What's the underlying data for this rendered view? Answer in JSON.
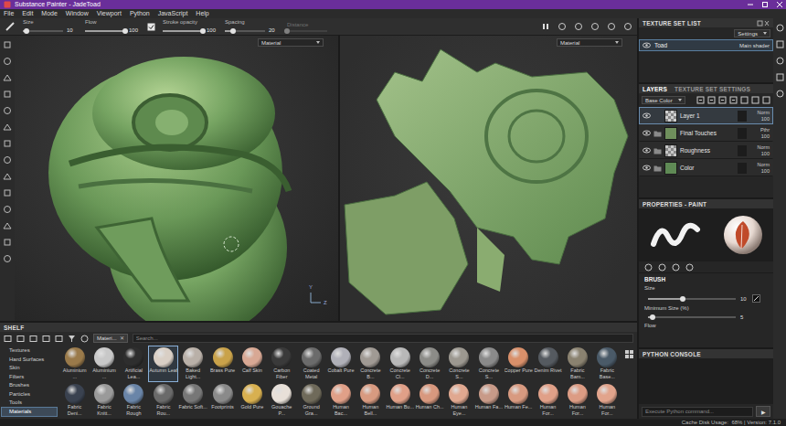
{
  "window": {
    "title": "Substance Painter - JadeToad"
  },
  "menu": [
    "File",
    "Edit",
    "Mode",
    "Window",
    "Viewport",
    "Python",
    "JavaScript",
    "Help"
  ],
  "toolbar": {
    "params": [
      {
        "label": "Size",
        "value": "10",
        "level": 0.1,
        "disabled": false
      },
      {
        "label": "Flow",
        "value": "100",
        "level": 1,
        "disabled": false
      },
      {
        "label": "Stroke opacity",
        "value": "100",
        "level": 1,
        "disabled": false
      },
      {
        "label": "Spacing",
        "value": "20",
        "level": 0.2,
        "disabled": false
      },
      {
        "label": "Distance",
        "value": "",
        "level": 0,
        "disabled": true
      }
    ]
  },
  "viewport_3d": {
    "dropdown": "Material",
    "axes": [
      "Y",
      "Z"
    ]
  },
  "viewport_2d": {
    "dropdown": "Material"
  },
  "texture_set_list": {
    "title": "TEXTURE SET LIST",
    "settings": "Settings",
    "items": [
      {
        "name": "Toad",
        "shader": "Main shader",
        "selected": true,
        "visible": true
      }
    ]
  },
  "layers": {
    "tabs": [
      {
        "label": "LAYERS",
        "selected": true
      },
      {
        "label": "TEXTURE SET SETTINGS",
        "selected": false
      }
    ],
    "channel": "Base Color",
    "items": [
      {
        "name": "Layer 1",
        "kind": "layer",
        "thumb": "checker",
        "color": "#d0d0d0",
        "blend": "Norm",
        "opacity": "100",
        "selected": true,
        "visible": true
      },
      {
        "name": "Final Touches",
        "kind": "folder",
        "thumb": "solid",
        "color": "#6f8f5c",
        "blend": "Pthr",
        "opacity": "100",
        "selected": false,
        "visible": true
      },
      {
        "name": "Roughness",
        "kind": "folder",
        "thumb": "checker",
        "color": "#c8c8c8",
        "blend": "Norm",
        "opacity": "100",
        "selected": false,
        "visible": true
      },
      {
        "name": "Color",
        "kind": "folder",
        "thumb": "solid",
        "color": "#5f8a55",
        "blend": "Norm",
        "opacity": "100",
        "selected": false,
        "visible": true
      }
    ]
  },
  "properties": {
    "title": "PROPERTIES - PAINT",
    "section": "BRUSH",
    "params": [
      {
        "label": "Size",
        "value": "10",
        "level": 0.4
      },
      {
        "label": "Minimum Size (%)",
        "value": "5",
        "level": 0.05
      }
    ],
    "extra_label": "Flow"
  },
  "python_console": {
    "title": "PYTHON CONSOLE",
    "placeholder": "Execute Python command...",
    "run": "▶"
  },
  "shelf": {
    "title": "SHELF",
    "categories": [
      {
        "label": "Textures",
        "selected": false
      },
      {
        "label": "Hard Surfaces",
        "selected": false
      },
      {
        "label": "Skin",
        "selected": false
      },
      {
        "label": "Filters",
        "selected": false
      },
      {
        "label": "Brushes",
        "selected": false
      },
      {
        "label": "Particles",
        "selected": false
      },
      {
        "label": "Tools",
        "selected": false
      },
      {
        "label": "Materials",
        "selected": true
      }
    ],
    "tab": {
      "label": "Materi...",
      "close": "✕"
    },
    "search": {
      "placeholder": "Search..."
    },
    "rows": [
      [
        {
          "name": "Aluminium ...",
          "color": "#9a7a4a",
          "selected": false
        },
        {
          "name": "Aluminium ...",
          "color": "#c8c8c8",
          "selected": false
        },
        {
          "name": "Artificial Lea...",
          "color": "#2e2e2e",
          "selected": false
        },
        {
          "name": "Autumn Leaf",
          "color": "#d9cfc5",
          "selected": true
        },
        {
          "name": "Baked Light...",
          "color": "#b9b0a8",
          "selected": false
        },
        {
          "name": "Brass Pure",
          "color": "#c9a24a",
          "selected": false
        },
        {
          "name": "Calf Skin",
          "color": "#d8a894",
          "selected": false
        },
        {
          "name": "Carbon Fiber",
          "color": "#3a3a3a",
          "selected": false
        },
        {
          "name": "Coated Metal",
          "color": "#6b6b6b",
          "selected": false
        },
        {
          "name": "Cobalt Pure",
          "color": "#b0b0b8",
          "selected": false
        },
        {
          "name": "Concrete B...",
          "color": "#a09a94",
          "selected": false
        },
        {
          "name": "Concrete Cl...",
          "color": "#b8b8b8",
          "selected": false
        },
        {
          "name": "Concrete D...",
          "color": "#8c8c88",
          "selected": false
        },
        {
          "name": "Concrete S...",
          "color": "#9c9890",
          "selected": false
        },
        {
          "name": "Concrete S...",
          "color": "#8a8a8a",
          "selected": false
        },
        {
          "name": "Copper Pure",
          "color": "#d9906a",
          "selected": false
        },
        {
          "name": "Denim Rivet",
          "color": "#555a60",
          "selected": false
        },
        {
          "name": "Fabric Bam...",
          "color": "#8a8270",
          "selected": false
        },
        {
          "name": "Fabric Base...",
          "color": "#4a5a68",
          "selected": false
        }
      ],
      [
        {
          "name": "Fabric Deni...",
          "color": "#3a4250",
          "selected": false
        },
        {
          "name": "Fabric Knitt...",
          "color": "#9a9a9a",
          "selected": false
        },
        {
          "name": "Fabric Rough",
          "color": "#6a85a8",
          "selected": false
        },
        {
          "name": "Fabric Rou...",
          "color": "#6a6a6a",
          "selected": false
        },
        {
          "name": "Fabric Soft...",
          "color": "#777777",
          "selected": false
        },
        {
          "name": "Footprints",
          "color": "#8a8a8a",
          "selected": false
        },
        {
          "name": "Gold Pure",
          "color": "#d8b050",
          "selected": false
        },
        {
          "name": "Gouache P...",
          "color": "#e8e0d8",
          "selected": false
        },
        {
          "name": "Ground Gra...",
          "color": "#6f6a5a",
          "selected": false
        },
        {
          "name": "Human Bac...",
          "color": "#e0a088",
          "selected": false
        },
        {
          "name": "Human Bell...",
          "color": "#d89a80",
          "selected": false
        },
        {
          "name": "Human Bu...",
          "color": "#e0a088",
          "selected": false
        },
        {
          "name": "Human Ch...",
          "color": "#d8987e",
          "selected": false
        },
        {
          "name": "Human Eye...",
          "color": "#e0a890",
          "selected": false
        },
        {
          "name": "Human Fa...",
          "color": "#c89a88",
          "selected": false
        },
        {
          "name": "Human Fe...",
          "color": "#d89a80",
          "selected": false
        },
        {
          "name": "Human For...",
          "color": "#e0a088",
          "selected": false
        },
        {
          "name": "Human For...",
          "color": "#dc9c84",
          "selected": false
        },
        {
          "name": "Human For...",
          "color": "#e2a48c",
          "selected": false
        }
      ]
    ]
  },
  "status_bar": {
    "text": "Cache Disk Usage:  68% | Version: 7.1.0"
  }
}
